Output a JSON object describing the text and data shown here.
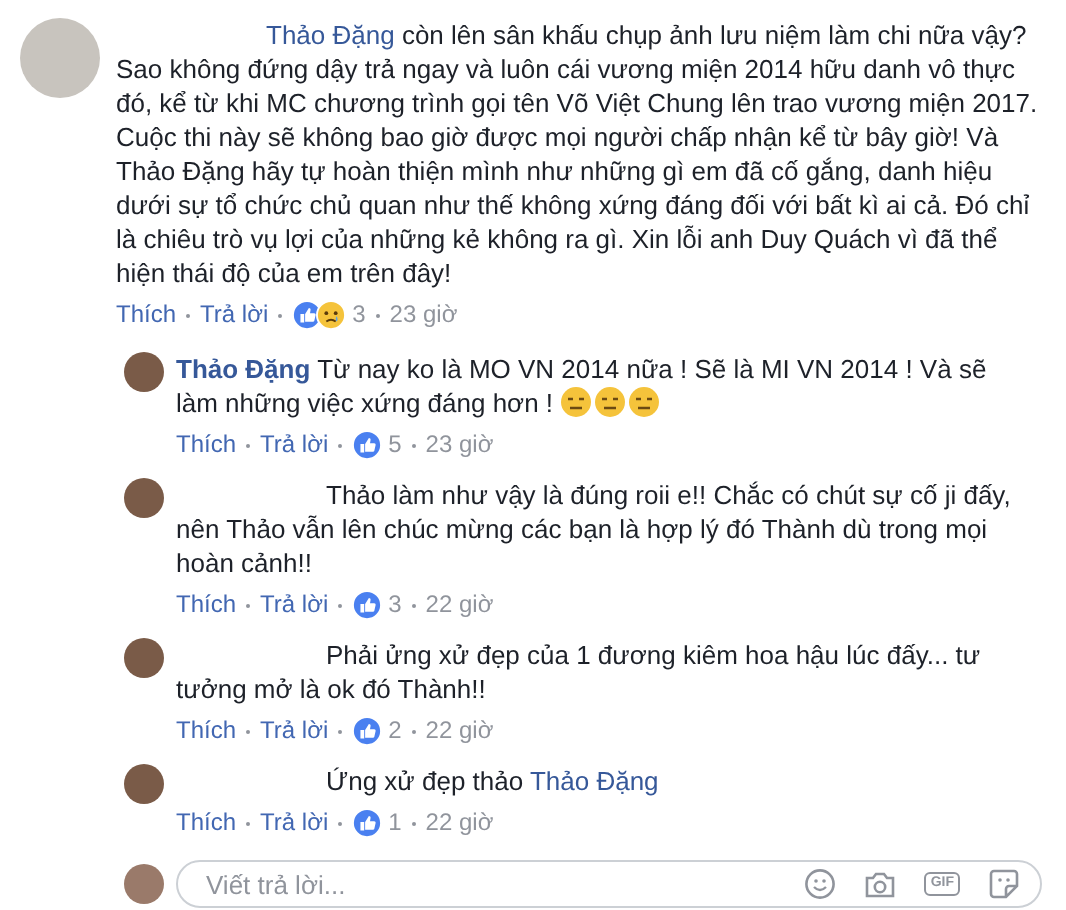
{
  "comment": {
    "body": [
      {
        "kind": "mention",
        "text": "Thảo Đặng"
      },
      {
        "kind": "text",
        "text": " còn lên sân khấu chụp ảnh lưu niệm làm chi nữa vậy? Sao không đứng dậy trả ngay và luôn cái vương miện 2014 hữu danh vô thực đó, kể từ khi MC chương trình gọi tên Võ Việt Chung lên trao vương miện 2017. Cuộc thi này sẽ không bao giờ được mọi người chấp nhận kể từ bây giờ! Và Thảo Đặng hãy tự hoàn thiện mình như những gì em đã cố gắng, danh hiệu dưới sự tổ chức chủ quan như thế không xứng đáng đối với bất kì ai cả. Đó chỉ là chiêu trò vụ lợi của những kẻ không ra gì. Xin lỗi anh Duy Quách vì đã thể hiện thái độ của em trên đây!"
      }
    ],
    "like_label": "Thích",
    "reply_label": "Trả lời",
    "reactions": [
      {
        "kind": "like"
      },
      {
        "kind": "sad"
      }
    ],
    "reaction_count": "3",
    "time": "23 giờ"
  },
  "replies": [
    {
      "author": "Thảo Đặng",
      "body": [
        {
          "kind": "text",
          "text": "Từ nay ko là MO VN 2014 nữa ! Sẽ là MI VN 2014 ! Và sẽ làm những việc xứng đáng hơn ! "
        }
      ],
      "emojis": [
        {
          "kind": "expressionless"
        },
        {
          "kind": "expressionless"
        },
        {
          "kind": "expressionless"
        }
      ],
      "like_label": "Thích",
      "reply_label": "Trả lời",
      "reactions": [
        {
          "kind": "like"
        }
      ],
      "reaction_count": "5",
      "time": "23 giờ"
    },
    {
      "body": [
        {
          "kind": "text",
          "text": "Thảo làm như vậy là đúng roii e!! Chắc có chút sự cố ji đấy, nên Thảo vẫn lên chúc mừng các bạn là hợp lý đó Thành dù trong mọi hoàn cảnh!!"
        }
      ],
      "like_label": "Thích",
      "reply_label": "Trả lời",
      "reactions": [
        {
          "kind": "like"
        }
      ],
      "reaction_count": "3",
      "time": "22 giờ"
    },
    {
      "body": [
        {
          "kind": "text",
          "text": "Phải ửng xử đẹp của 1 đương kiêm hoa hậu lúc đấy... tư tưởng mở là ok đó Thành!!"
        }
      ],
      "like_label": "Thích",
      "reply_label": "Trả lời",
      "reactions": [
        {
          "kind": "like"
        }
      ],
      "reaction_count": "2",
      "time": "22 giờ"
    },
    {
      "body": [
        {
          "kind": "text",
          "text": "Ứng xử đẹp thảo "
        },
        {
          "kind": "mention",
          "text": "Thảo Đặng"
        }
      ],
      "like_label": "Thích",
      "reply_label": "Trả lời",
      "reactions": [
        {
          "kind": "like"
        }
      ],
      "reaction_count": "1",
      "time": "22 giờ"
    }
  ],
  "reply_box": {
    "placeholder": "Viết trả lời...",
    "gif_label": "GIF"
  }
}
